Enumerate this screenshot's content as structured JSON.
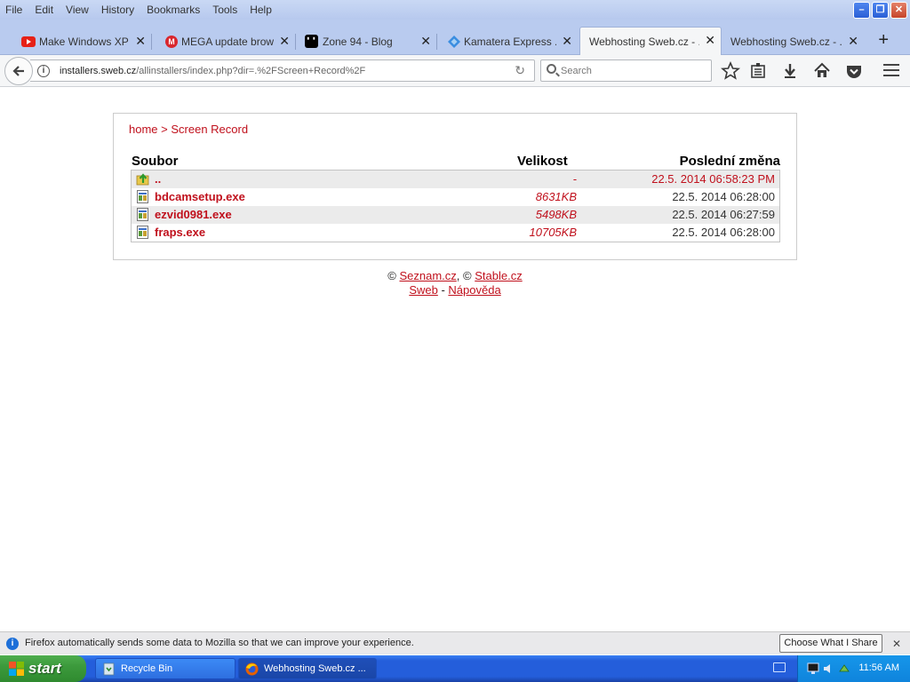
{
  "menubar": {
    "items": [
      "File",
      "Edit",
      "View",
      "History",
      "Bookmarks",
      "Tools",
      "Help"
    ]
  },
  "tabs": [
    {
      "label": "Make Windows XP ...",
      "icon": "youtube-icon",
      "color": "#e62117"
    },
    {
      "label": "MEGA update brow...",
      "icon": "mega-icon",
      "color": "#d9272e"
    },
    {
      "label": "Zone 94 - Blog",
      "icon": "zone94-icon",
      "color": "#000000"
    },
    {
      "label": "Kamatera Express ...",
      "icon": "kamatera-icon",
      "color": "#3a8de0"
    },
    {
      "label": "Webhosting Sweb.cz - ...",
      "icon": "none",
      "color": ""
    },
    {
      "label": "Webhosting Sweb.cz - ...",
      "icon": "none",
      "color": ""
    }
  ],
  "navbar": {
    "url_domain": "installers.sweb.cz",
    "url_path": "/allinstallers/index.php?dir=.%2FScreen+Record%2F",
    "search_placeholder": "Search"
  },
  "page": {
    "breadcrumb_home": "home",
    "breadcrumb_sep": " > ",
    "breadcrumb_current": "Screen Record",
    "columns": {
      "name": "Soubor",
      "size": "Velikost",
      "modified": "Poslední změna"
    },
    "rows": [
      {
        "name": "..",
        "size": "-",
        "modified": "22.5. 2014 06:58:23 PM",
        "icon": "up-folder-icon"
      },
      {
        "name": "bdcamsetup.exe",
        "size": "8631KB",
        "modified": "22.5. 2014 06:28:00",
        "icon": "exe-file-icon"
      },
      {
        "name": "ezvid0981.exe",
        "size": "5498KB",
        "modified": "22.5. 2014 06:27:59",
        "icon": "exe-file-icon"
      },
      {
        "name": "fraps.exe",
        "size": "10705KB",
        "modified": "22.5. 2014 06:28:00",
        "icon": "exe-file-icon"
      }
    ],
    "footer": {
      "copy1": "© ",
      "link1": "Seznam.cz",
      "copy2": ", © ",
      "link2": "Stable.cz",
      "link3": "Sweb",
      "dash": " - ",
      "link4": "Nápověda"
    }
  },
  "notification": {
    "text": "Firefox automatically sends some data to Mozilla so that we can improve your experience.",
    "button": "Choose What I Share"
  },
  "taskbar": {
    "start": "start",
    "items": [
      "Recycle Bin",
      "Webhosting Sweb.cz ..."
    ],
    "clock": "11:56 AM"
  },
  "colors": {
    "link": "#c0101c",
    "taskbar": "#245edb",
    "start": "#3c9a3c"
  }
}
